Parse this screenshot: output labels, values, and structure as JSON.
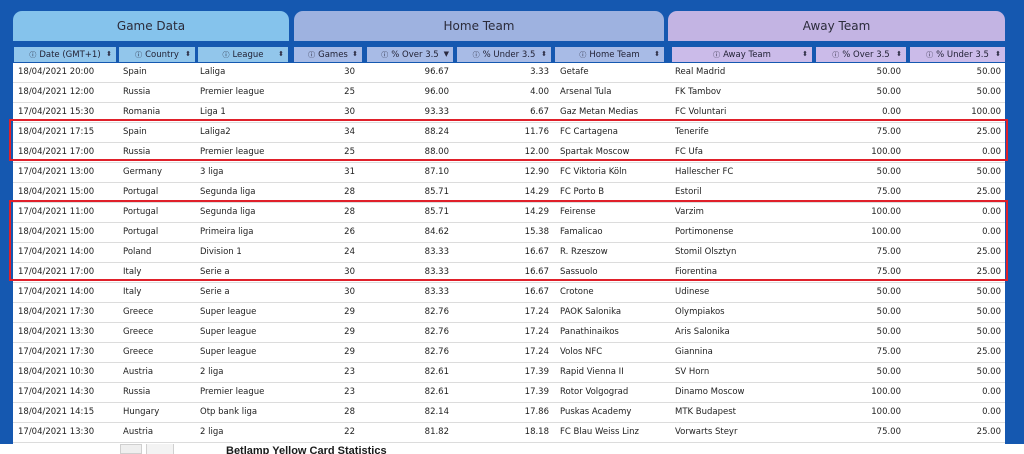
{
  "groups": {
    "game": "Game Data",
    "home": "Home Team",
    "away": "Away Team"
  },
  "columns": [
    {
      "label": "Date (GMT+1)",
      "icon": "info-icon",
      "sort": "⬍"
    },
    {
      "label": "Country",
      "icon": "info-icon",
      "sort": "⬍"
    },
    {
      "label": "League",
      "icon": "info-icon",
      "sort": "⬍"
    },
    {
      "label": "Games",
      "icon": "info-icon",
      "sort": "⬍"
    },
    {
      "label": "% Over 3.5",
      "icon": "info-icon",
      "sort": "▼"
    },
    {
      "label": "% Under 3.5",
      "icon": "info-icon",
      "sort": "⬍"
    },
    {
      "label": "Home Team",
      "icon": "info-icon",
      "sort": "⬍"
    },
    {
      "label": "Away Team",
      "icon": "info-icon",
      "sort": "⬍"
    },
    {
      "label": "% Over 3.5",
      "icon": "info-icon",
      "sort": "⬍"
    },
    {
      "label": "% Under 3.5",
      "icon": "info-icon",
      "sort": "⬍"
    }
  ],
  "rows": [
    [
      "18/04/2021 20:00",
      "Spain",
      "Laliga",
      "30",
      "96.67",
      "3.33",
      "Getafe",
      "Real Madrid",
      "50.00",
      "50.00"
    ],
    [
      "18/04/2021 12:00",
      "Russia",
      "Premier league",
      "25",
      "96.00",
      "4.00",
      "Arsenal Tula",
      "FK Tambov",
      "50.00",
      "50.00"
    ],
    [
      "17/04/2021 15:30",
      "Romania",
      "Liga 1",
      "30",
      "93.33",
      "6.67",
      "Gaz Metan Medias",
      "FC Voluntari",
      "0.00",
      "100.00"
    ],
    [
      "18/04/2021 17:15",
      "Spain",
      "Laliga2",
      "34",
      "88.24",
      "11.76",
      "FC Cartagena",
      "Tenerife",
      "75.00",
      "25.00"
    ],
    [
      "18/04/2021 17:00",
      "Russia",
      "Premier league",
      "25",
      "88.00",
      "12.00",
      "Spartak Moscow",
      "FC Ufa",
      "100.00",
      "0.00"
    ],
    [
      "17/04/2021 13:00",
      "Germany",
      "3 liga",
      "31",
      "87.10",
      "12.90",
      "FC Viktoria Köln",
      "Hallescher FC",
      "50.00",
      "50.00"
    ],
    [
      "18/04/2021 15:00",
      "Portugal",
      "Segunda liga",
      "28",
      "85.71",
      "14.29",
      "FC Porto B",
      "Estoril",
      "75.00",
      "25.00"
    ],
    [
      "17/04/2021 11:00",
      "Portugal",
      "Segunda liga",
      "28",
      "85.71",
      "14.29",
      "Feirense",
      "Varzim",
      "100.00",
      "0.00"
    ],
    [
      "18/04/2021 15:00",
      "Portugal",
      "Primeira liga",
      "26",
      "84.62",
      "15.38",
      "Famalicao",
      "Portimonense",
      "100.00",
      "0.00"
    ],
    [
      "17/04/2021 14:00",
      "Poland",
      "Division 1",
      "24",
      "83.33",
      "16.67",
      "R. Rzeszow",
      "Stomil Olsztyn",
      "75.00",
      "25.00"
    ],
    [
      "17/04/2021 17:00",
      "Italy",
      "Serie a",
      "30",
      "83.33",
      "16.67",
      "Sassuolo",
      "Fiorentina",
      "75.00",
      "25.00"
    ],
    [
      "17/04/2021 14:00",
      "Italy",
      "Serie a",
      "30",
      "83.33",
      "16.67",
      "Crotone",
      "Udinese",
      "50.00",
      "50.00"
    ],
    [
      "18/04/2021 17:30",
      "Greece",
      "Super league",
      "29",
      "82.76",
      "17.24",
      "PAOK Salonika",
      "Olympiakos",
      "50.00",
      "50.00"
    ],
    [
      "18/04/2021 13:30",
      "Greece",
      "Super league",
      "29",
      "82.76",
      "17.24",
      "Panathinaikos",
      "Aris Salonika",
      "50.00",
      "50.00"
    ],
    [
      "17/04/2021 17:30",
      "Greece",
      "Super league",
      "29",
      "82.76",
      "17.24",
      "Volos NFC",
      "Giannina",
      "75.00",
      "25.00"
    ],
    [
      "18/04/2021 10:30",
      "Austria",
      "2 liga",
      "23",
      "82.61",
      "17.39",
      "Rapid Vienna II",
      "SV Horn",
      "50.00",
      "50.00"
    ],
    [
      "17/04/2021 14:30",
      "Russia",
      "Premier league",
      "23",
      "82.61",
      "17.39",
      "Rotor Volgograd",
      "Dinamo Moscow",
      "100.00",
      "0.00"
    ],
    [
      "18/04/2021 14:15",
      "Hungary",
      "Otp bank liga",
      "28",
      "82.14",
      "17.86",
      "Puskas Academy",
      "MTK Budapest",
      "100.00",
      "0.00"
    ],
    [
      "17/04/2021 13:30",
      "Austria",
      "2 liga",
      "22",
      "81.82",
      "18.18",
      "FC Blau Weiss Linz",
      "Vorwarts Steyr",
      "75.00",
      "25.00"
    ]
  ],
  "below_title": "Betlamp Yellow Card Statistics",
  "colors": {
    "frame": "#1558b0",
    "game_tab": "#85c3ec",
    "home_tab": "#9eb2e0",
    "away_tab": "#c3b4e3",
    "highlight": "#e0202a"
  }
}
